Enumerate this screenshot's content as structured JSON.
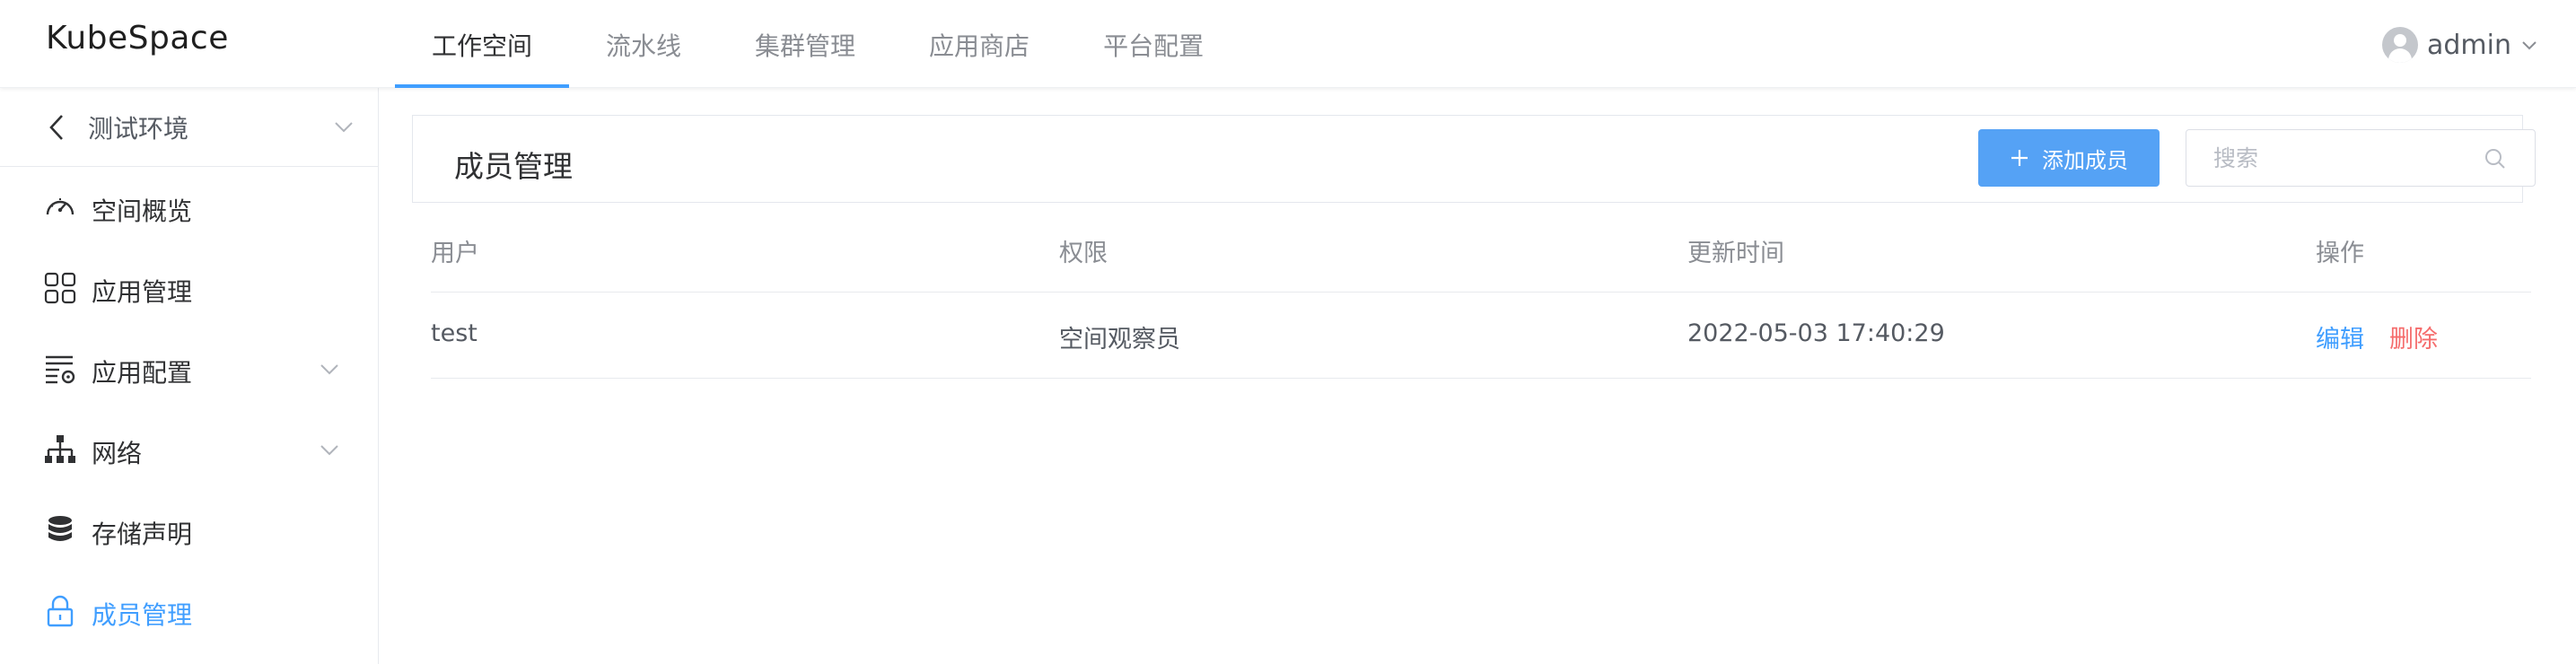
{
  "app": {
    "logo": "KubeSpace"
  },
  "nav": {
    "items": [
      "工作空间",
      "流水线",
      "集群管理",
      "应用商店",
      "平台配置"
    ],
    "active_index": 0
  },
  "user": {
    "name": "admin"
  },
  "sidebar": {
    "space": "测试环境",
    "items": [
      {
        "label": "空间概览",
        "icon": "dashboard-gauge-icon"
      },
      {
        "label": "应用管理",
        "icon": "grid-apps-icon"
      },
      {
        "label": "应用配置",
        "icon": "config-list-gear-icon",
        "expandable": true
      },
      {
        "label": "网络",
        "icon": "network-tree-icon",
        "expandable": true
      },
      {
        "label": "存储声明",
        "icon": "database-stack-icon"
      },
      {
        "label": "成员管理",
        "icon": "lock-icon",
        "active": true
      }
    ]
  },
  "main": {
    "title": "成员管理",
    "add_button": "添加成员",
    "search_placeholder": "搜索",
    "table": {
      "headers": [
        "用户",
        "权限",
        "更新时间",
        "操作"
      ],
      "rows": [
        {
          "user": "test",
          "role": "空间观察员",
          "updated": "2022-05-03 17:40:29",
          "edit": "编辑",
          "delete": "删除"
        }
      ]
    }
  },
  "colors": {
    "accent": "#409eff",
    "danger": "#f56c6c",
    "button": "#55a2f5"
  }
}
